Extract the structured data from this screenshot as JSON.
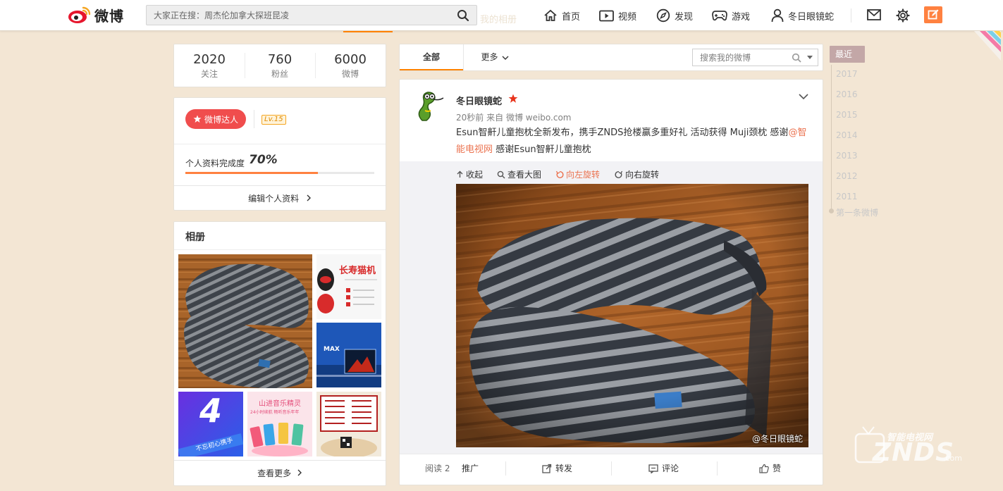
{
  "header": {
    "logo_text": "微博",
    "search_placeholder": "大家正在搜：周杰伦加拿大探班昆凌",
    "ghost_text": "我的相册",
    "nav": {
      "home": "首页",
      "video": "视频",
      "discover": "发现",
      "game": "游戏",
      "user": "冬日眼镜蛇"
    }
  },
  "stats": {
    "following": {
      "num": "2020",
      "label": "关注"
    },
    "fans": {
      "num": "760",
      "label": "粉丝"
    },
    "weibo": {
      "num": "6000",
      "label": "微博"
    }
  },
  "profile": {
    "badge": "微博达人",
    "level": "Lv.15",
    "completion_label": "个人资料完成度",
    "completion_pct": "70%",
    "completion_value": 0.7,
    "edit_link": "编辑个人资料"
  },
  "album": {
    "title": "相册",
    "more": "查看更多",
    "thumb_texts": {
      "t2": "长寿猫机",
      "t3": "MAX",
      "t4a": "4",
      "t4b": "不忘初心携手",
      "t5a": "山进音乐精灵",
      "t5b": "24小时续航 畅听音乐年年"
    }
  },
  "feed": {
    "tabs": {
      "all": "全部",
      "more": "更多"
    },
    "search_placeholder": "搜索我的微博"
  },
  "post": {
    "username": "冬日眼镜蛇",
    "time": "20秒前",
    "source_prefix": "来自",
    "source": "微博 weibo.com",
    "text_part1": "Esun智鼾儿童抱枕全新发布，携手ZNDS抢楼赢多重好礼 活动获得 Muji颈枕 感谢",
    "mention": "@智能电视网",
    "text_part2": " 感谢Esun智鼾儿童抱枕",
    "tools": {
      "collapse": "收起",
      "view_large": "查看大图",
      "rotate_left": "向左旋转",
      "rotate_right": "向右旋转"
    },
    "watermark": "@冬日眼镜蛇",
    "actions": {
      "read": "阅读 2",
      "promote": "推广",
      "forward": "转发",
      "comment": "评论",
      "like": "赞"
    }
  },
  "timeline": {
    "current": "最近",
    "years": [
      "2017",
      "2016",
      "2015",
      "2014",
      "2013",
      "2012",
      "2011"
    ],
    "first": "第一条微博"
  },
  "site_watermark": {
    "cn": "智能电视网",
    "en": "ZNDS",
    "suffix": ".com"
  },
  "colors": {
    "accent": "#ff8200",
    "badge": "#f04d4d",
    "link": "#eb7350",
    "bg": "#f3e6d4"
  }
}
